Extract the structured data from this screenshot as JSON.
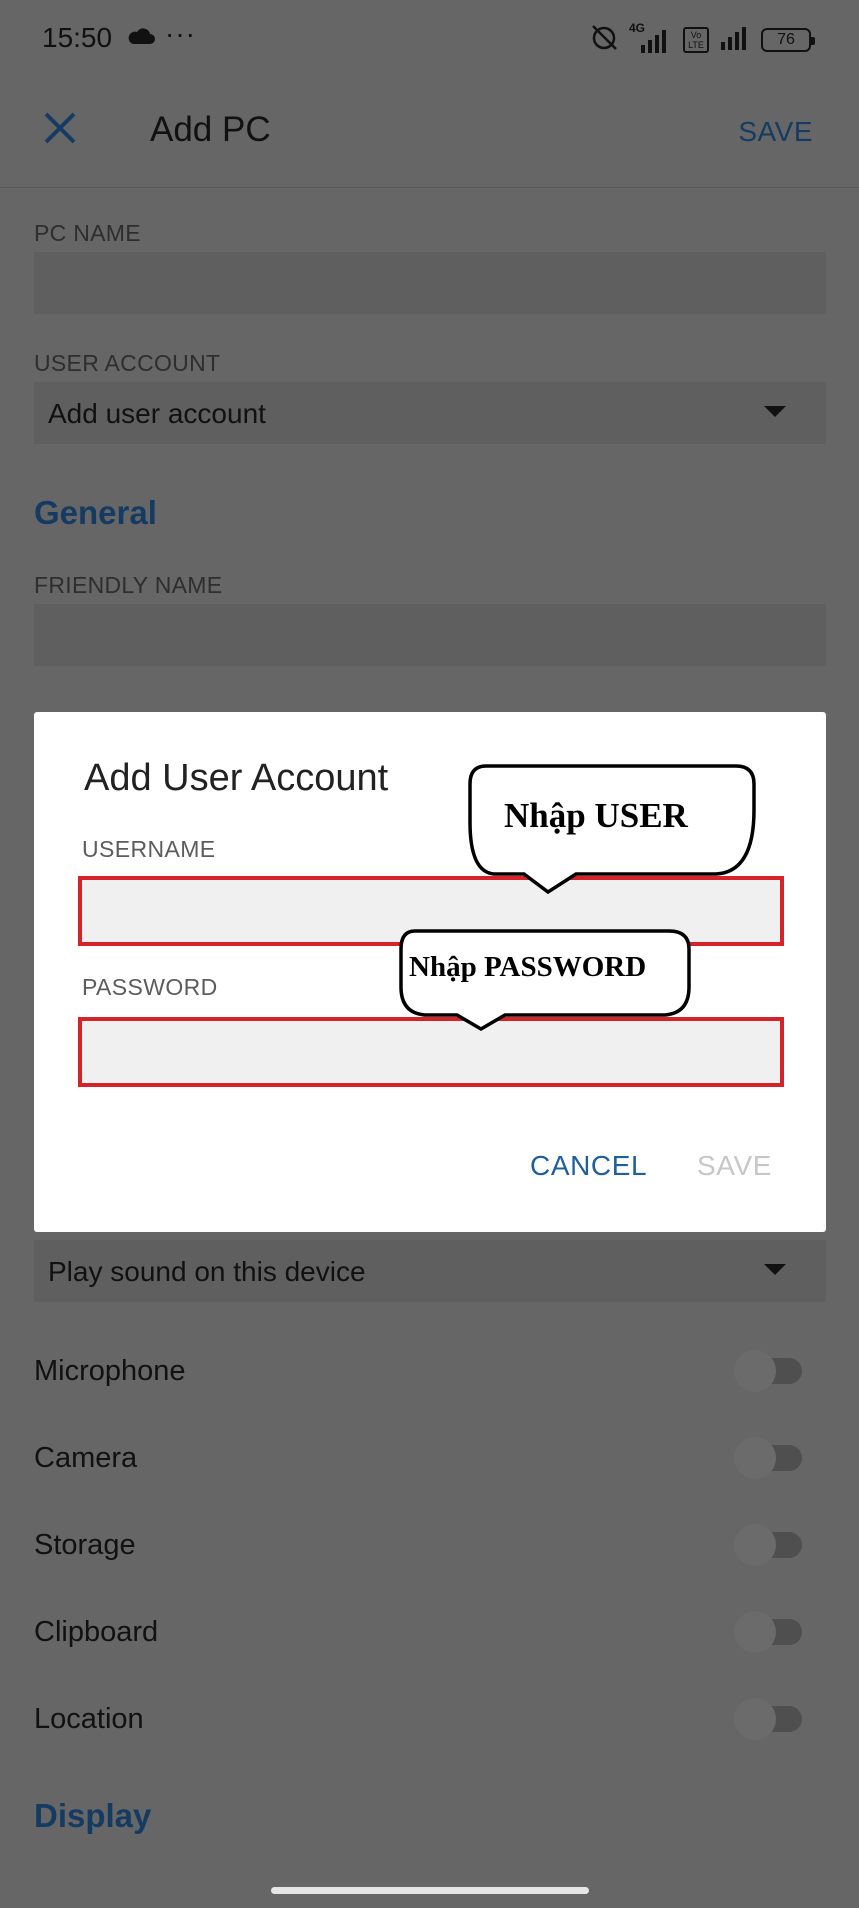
{
  "status_bar": {
    "time": "15:50",
    "more": "···",
    "network_label": "4G",
    "volte_label": "Vo LTE",
    "battery": "76"
  },
  "app_bar": {
    "title": "Add PC",
    "save_label": "SAVE"
  },
  "form": {
    "pc_name_label": "PC NAME",
    "user_account_label": "USER ACCOUNT",
    "user_account_value": "Add user account",
    "general_heading": "General",
    "friendly_name_label": "FRIENDLY NAME",
    "sound_value": "Play sound on this device",
    "toggles": [
      {
        "label": "Microphone",
        "on": false
      },
      {
        "label": "Camera",
        "on": false
      },
      {
        "label": "Storage",
        "on": false
      },
      {
        "label": "Clipboard",
        "on": false
      },
      {
        "label": "Location",
        "on": false
      }
    ],
    "display_heading": "Display"
  },
  "dialog": {
    "title": "Add User Account",
    "username_label": "USERNAME",
    "username_value": "",
    "password_label": "PASSWORD",
    "password_value": "",
    "cancel_label": "CANCEL",
    "save_label": "SAVE"
  },
  "annotations": {
    "user_callout": "Nhập USER",
    "password_callout": "Nhập PASSWORD",
    "highlight_color": "#d6232a"
  },
  "colors": {
    "accent": "#163b63",
    "dialog_action": "#1e5f9e",
    "scrim": "#666666"
  }
}
